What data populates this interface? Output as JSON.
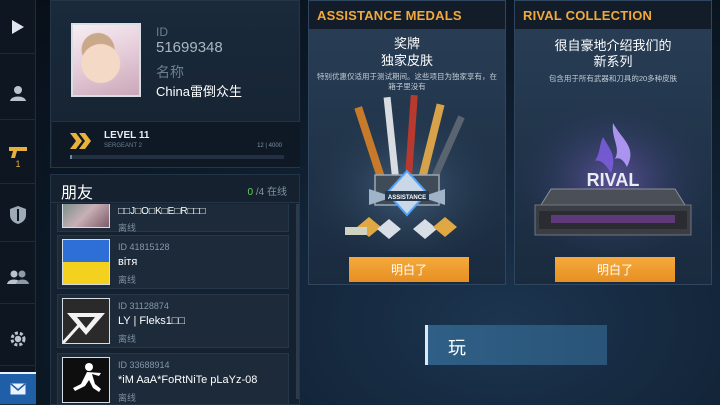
{
  "profile": {
    "id_label": "ID",
    "id_value": "51699348",
    "name_label": "名称",
    "name_value": "China雷倒众生",
    "level": "LEVEL 11",
    "rank": "SERGEANT 2",
    "xp_text": "12 | 4000",
    "xp_fraction": 0.003
  },
  "nav": {
    "items": [
      {
        "icon": "play-icon"
      },
      {
        "icon": "profile-icon"
      },
      {
        "icon": "pistol-icon",
        "count": "1"
      },
      {
        "icon": "clan-shield-icon"
      },
      {
        "icon": "friends-icon"
      },
      {
        "icon": "gear-icon"
      },
      {
        "icon": "mail-icon"
      }
    ]
  },
  "friends": {
    "title": "朋友",
    "online_count": "0",
    "online_rest": "/4 在线",
    "list": [
      {
        "id": "",
        "name": "□□J□O□K□E□R□□□",
        "status": "离线"
      },
      {
        "id": "ID 41815128",
        "name": "вітя",
        "status": "离线"
      },
      {
        "id": "ID 31128874",
        "name": "LY | Fleks1□□",
        "status": "离线"
      },
      {
        "id": "ID 33688914",
        "name": "*iM AaA*FoRtNiTe pLaYz-08",
        "status": "离线"
      }
    ]
  },
  "cards": [
    {
      "title": "ASSISTANCE MEDALS",
      "subtitle_line1": "奖牌",
      "subtitle_line2": "独家皮肤",
      "description": "特别优惠仅适用于测试期间。这些项目为独家享有，在箱子里没有",
      "art_label": "ASSISTANCE",
      "button": "明白了"
    },
    {
      "title": "RIVAL COLLECTION",
      "subtitle_line1": "很自豪地介绍我们的",
      "subtitle_line2": "新系列",
      "description": "包含用于所有武器和刀具的20多种皮肤",
      "art_label": "RIVAL",
      "button": "明白了"
    }
  ],
  "play_button": "玩",
  "colors": {
    "accent_orange": "#f2a93b",
    "button_orange": "#ef9d2f",
    "online_green": "#5fd35f",
    "mail_blue": "#1e5fa8"
  }
}
